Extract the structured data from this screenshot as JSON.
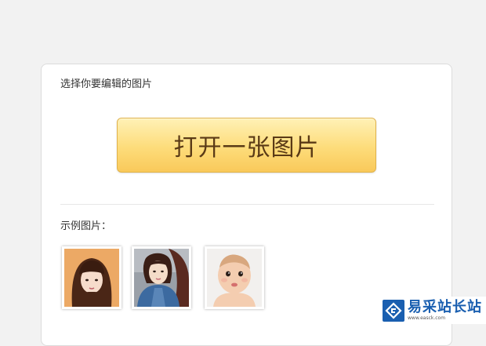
{
  "editor": {
    "title": "选择你要编辑的图片",
    "open_button_label": "打开一张图片",
    "examples_label": "示例图片："
  },
  "examples": [
    {
      "name": "example-photo-woman-bangs"
    },
    {
      "name": "example-photo-woman-selfie"
    },
    {
      "name": "example-photo-baby"
    }
  ],
  "watermark": {
    "name": "易采站长站",
    "url": "www.easck.com"
  },
  "colors": {
    "button_top": "#fff1b6",
    "button_bottom": "#f9c95a",
    "button_border": "#e0b24a",
    "button_text": "#5a3a16",
    "watermark_brand": "#1a5fb0"
  }
}
